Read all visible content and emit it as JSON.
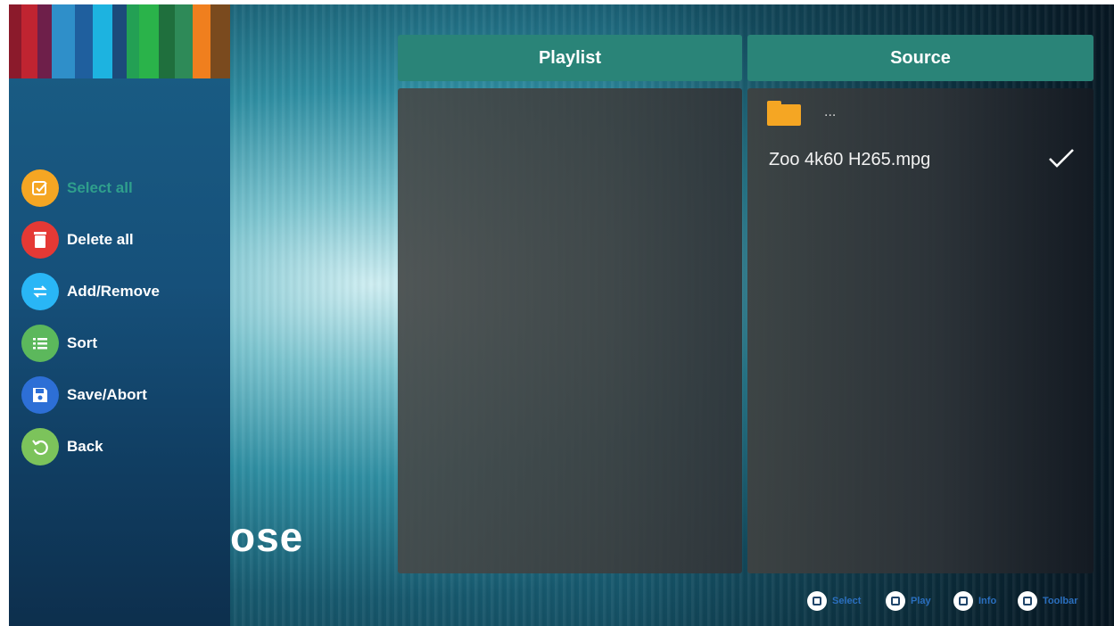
{
  "sidebar": {
    "stripe_colors": [
      "#8b1a2b",
      "#c02431",
      "#6e1f4a",
      "#2f8fc9",
      "#1f5f9e",
      "#1db3e0",
      "#1c4a7a",
      "#23a054",
      "#2ab34a",
      "#1f6f3d",
      "#2e8a58",
      "#f07f1e",
      "#7a4a1e"
    ],
    "menu": [
      {
        "label": "Select all",
        "icon": "checkbox-edit-icon",
        "color": "#f5a623",
        "selected": true
      },
      {
        "label": "Delete all",
        "icon": "trash-icon",
        "color": "#e53935",
        "selected": false
      },
      {
        "label": "Add/Remove",
        "icon": "swap-arrows-icon",
        "color": "#29b6f6",
        "selected": false
      },
      {
        "label": "Sort",
        "icon": "list-icon",
        "color": "#5cb85c",
        "selected": false
      },
      {
        "label": "Save/Abort",
        "icon": "floppy-disk-icon",
        "color": "#2d6fd6",
        "selected": false
      },
      {
        "label": "Back",
        "icon": "refresh-back-icon",
        "color": "#7cc35b",
        "selected": false
      }
    ]
  },
  "background_text": "ose",
  "playlist": {
    "header": "Playlist",
    "items": []
  },
  "source": {
    "header": "Source",
    "parent_folder_label": "...",
    "files": [
      {
        "name": "Zoo 4k60 H265.mpg",
        "checked": true
      }
    ]
  },
  "footer": {
    "hints": [
      {
        "label": "Select",
        "icon": "ok-button-icon"
      },
      {
        "label": "Play",
        "icon": "play-button-icon"
      },
      {
        "label": "Info",
        "icon": "info-button-icon"
      },
      {
        "label": "Toolbar",
        "icon": "options-button-icon"
      }
    ]
  },
  "colors": {
    "header_teal": "#2a8478",
    "selected_label": "#2f9f8c",
    "folder": "#f5a623"
  }
}
